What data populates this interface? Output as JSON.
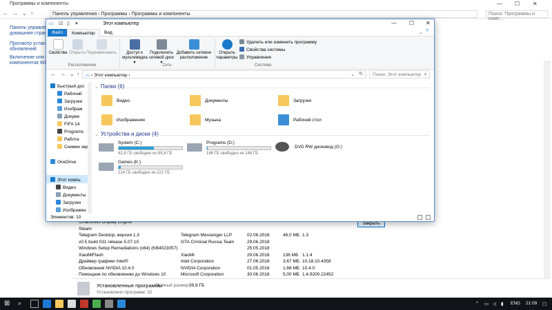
{
  "background_window": {
    "title": "Программы и компоненты",
    "breadcrumb": [
      "Панель управления",
      "Программы",
      "Программы и компоненты"
    ],
    "search_placeholder": "Поиск: Программы и комп...",
    "left_links": [
      "Панель управле...",
      "домашняя страниц",
      "Просмотр установ...",
      "обновлений",
      "Включение или отк...",
      "компонентов Window"
    ],
    "programs": [
      {
        "name": "Smartorect Display Engine",
        "publisher": "",
        "date": "",
        "size": "",
        "version": ""
      },
      {
        "name": "Steam",
        "publisher": "",
        "date": "",
        "size": "",
        "version": ""
      },
      {
        "name": "Telegram Desktop, версия 1.3",
        "publisher": "Telegram Messenger LLP",
        "date": "02.06.2018",
        "size": "46,0 МБ",
        "version": "1.3"
      },
      {
        "name": "v0.5 build 031 release 5.07.10",
        "publisher": "GTA Criminal Russia Team",
        "date": "29.06.2018",
        "size": "",
        "version": ""
      },
      {
        "name": "Windows Setup Remediations (x64) (KB4023057)",
        "publisher": "",
        "date": "25.05.2018",
        "size": "",
        "version": ""
      },
      {
        "name": "XiaoMiFlash",
        "publisher": "XiaoMi",
        "date": "29.06.2018",
        "size": "136 МБ",
        "version": "1.1.4"
      },
      {
        "name": "Драйвер графики Intel®",
        "publisher": "Intel Corporation",
        "date": "27.06.2018",
        "size": "3,67 МБ",
        "version": "10.18.10.4358"
      },
      {
        "name": "Обновления NVIDIA 10.4.0",
        "publisher": "NVIDIA Corporation",
        "date": "01.05.2018",
        "size": "1,68 МБ",
        "version": "10.4.0"
      },
      {
        "name": "Помощник по обновлению до Windows 10",
        "publisher": "Microsoft Corporation",
        "date": "30.06.2018",
        "size": "5,00 МБ",
        "version": "1.4.9200.22452"
      }
    ],
    "status": {
      "label": "Установленные программы",
      "total_label": "Полный размер:",
      "total_value": "39,9 ГБ",
      "count": "Установлено программ: 32"
    },
    "close_button": "Закрыть"
  },
  "explorer": {
    "title": "Этот компьютер",
    "tabs": [
      "Файл",
      "Компьютер",
      "Вид"
    ],
    "ribbon": {
      "properties": "Свойства",
      "open": "Открыть",
      "rename": "Переименовать",
      "media_access": "Доступ к мультимедиа ▾",
      "map_drive": "Подключить сетевой диск ▾",
      "add_network": "Добавить сетевое расположение",
      "open_settings": "Открыть параметры",
      "uninstall": "Удалить или изменить программу",
      "system_props": "Свойства системы",
      "manage": "Управление",
      "group_location": "Расположение",
      "group_network": "Сеть",
      "group_system": "Система"
    },
    "address": "Этот компьютер",
    "search_placeholder": "Поиск: Этот компьютер",
    "nav_items": [
      "Быстрый дос",
      "Рабочий",
      "Загрузки",
      "Изображ",
      "Докуме",
      "FIFA 14",
      "Programs",
      "Работа",
      "Снимки экр",
      "OneDrive",
      "Этот компь",
      "Видео",
      "Документы",
      "Загрузки",
      "Изображен"
    ],
    "folders_header": "Папки (6)",
    "folders": [
      "Видео",
      "Документы",
      "Загрузки",
      "Изображения",
      "Музыка",
      "Рабочий стол"
    ],
    "drives_header": "Устройства и диски (4)",
    "drives": [
      {
        "name": "System (C:)",
        "free": "42,9 ГБ свободно из 95,8 ГБ",
        "used_fraction": 0.55
      },
      {
        "name": "Programs (D:)",
        "free": "146 ГБ свободно из 146 ГБ",
        "used_fraction": 0.01
      },
      {
        "name": "DVD RW дисковод (G:)",
        "free": "",
        "used_fraction": null
      },
      {
        "name": "Games (K:)",
        "free": "214 ГБ свободно из 221 ГБ",
        "used_fraction": 0.03
      }
    ],
    "status": "Элементов: 10"
  },
  "taskbar": {
    "lang": "ENG",
    "time": "21:09"
  }
}
